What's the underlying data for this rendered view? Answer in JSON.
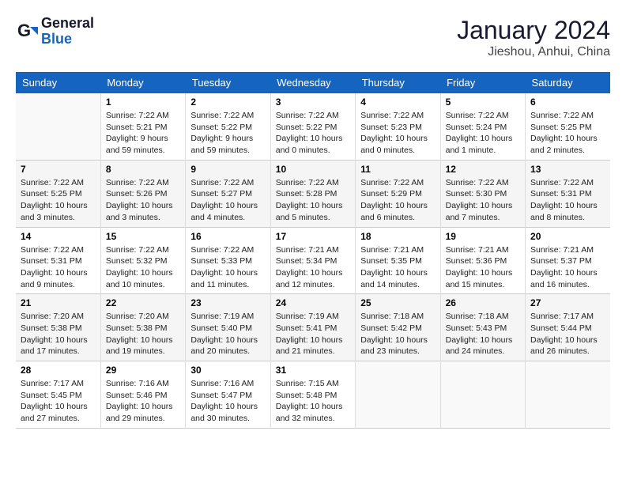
{
  "header": {
    "logo_general": "General",
    "logo_blue": "Blue",
    "title": "January 2024",
    "subtitle": "Jieshou, Anhui, China"
  },
  "weekdays": [
    "Sunday",
    "Monday",
    "Tuesday",
    "Wednesday",
    "Thursday",
    "Friday",
    "Saturday"
  ],
  "weeks": [
    [
      {
        "day": "",
        "info": ""
      },
      {
        "day": "1",
        "info": "Sunrise: 7:22 AM\nSunset: 5:21 PM\nDaylight: 9 hours\nand 59 minutes."
      },
      {
        "day": "2",
        "info": "Sunrise: 7:22 AM\nSunset: 5:22 PM\nDaylight: 9 hours\nand 59 minutes."
      },
      {
        "day": "3",
        "info": "Sunrise: 7:22 AM\nSunset: 5:22 PM\nDaylight: 10 hours\nand 0 minutes."
      },
      {
        "day": "4",
        "info": "Sunrise: 7:22 AM\nSunset: 5:23 PM\nDaylight: 10 hours\nand 0 minutes."
      },
      {
        "day": "5",
        "info": "Sunrise: 7:22 AM\nSunset: 5:24 PM\nDaylight: 10 hours\nand 1 minute."
      },
      {
        "day": "6",
        "info": "Sunrise: 7:22 AM\nSunset: 5:25 PM\nDaylight: 10 hours\nand 2 minutes."
      }
    ],
    [
      {
        "day": "7",
        "info": "Sunrise: 7:22 AM\nSunset: 5:25 PM\nDaylight: 10 hours\nand 3 minutes."
      },
      {
        "day": "8",
        "info": "Sunrise: 7:22 AM\nSunset: 5:26 PM\nDaylight: 10 hours\nand 3 minutes."
      },
      {
        "day": "9",
        "info": "Sunrise: 7:22 AM\nSunset: 5:27 PM\nDaylight: 10 hours\nand 4 minutes."
      },
      {
        "day": "10",
        "info": "Sunrise: 7:22 AM\nSunset: 5:28 PM\nDaylight: 10 hours\nand 5 minutes."
      },
      {
        "day": "11",
        "info": "Sunrise: 7:22 AM\nSunset: 5:29 PM\nDaylight: 10 hours\nand 6 minutes."
      },
      {
        "day": "12",
        "info": "Sunrise: 7:22 AM\nSunset: 5:30 PM\nDaylight: 10 hours\nand 7 minutes."
      },
      {
        "day": "13",
        "info": "Sunrise: 7:22 AM\nSunset: 5:31 PM\nDaylight: 10 hours\nand 8 minutes."
      }
    ],
    [
      {
        "day": "14",
        "info": "Sunrise: 7:22 AM\nSunset: 5:31 PM\nDaylight: 10 hours\nand 9 minutes."
      },
      {
        "day": "15",
        "info": "Sunrise: 7:22 AM\nSunset: 5:32 PM\nDaylight: 10 hours\nand 10 minutes."
      },
      {
        "day": "16",
        "info": "Sunrise: 7:22 AM\nSunset: 5:33 PM\nDaylight: 10 hours\nand 11 minutes."
      },
      {
        "day": "17",
        "info": "Sunrise: 7:21 AM\nSunset: 5:34 PM\nDaylight: 10 hours\nand 12 minutes."
      },
      {
        "day": "18",
        "info": "Sunrise: 7:21 AM\nSunset: 5:35 PM\nDaylight: 10 hours\nand 14 minutes."
      },
      {
        "day": "19",
        "info": "Sunrise: 7:21 AM\nSunset: 5:36 PM\nDaylight: 10 hours\nand 15 minutes."
      },
      {
        "day": "20",
        "info": "Sunrise: 7:21 AM\nSunset: 5:37 PM\nDaylight: 10 hours\nand 16 minutes."
      }
    ],
    [
      {
        "day": "21",
        "info": "Sunrise: 7:20 AM\nSunset: 5:38 PM\nDaylight: 10 hours\nand 17 minutes."
      },
      {
        "day": "22",
        "info": "Sunrise: 7:20 AM\nSunset: 5:38 PM\nDaylight: 10 hours\nand 19 minutes."
      },
      {
        "day": "23",
        "info": "Sunrise: 7:19 AM\nSunset: 5:40 PM\nDaylight: 10 hours\nand 20 minutes."
      },
      {
        "day": "24",
        "info": "Sunrise: 7:19 AM\nSunset: 5:41 PM\nDaylight: 10 hours\nand 21 minutes."
      },
      {
        "day": "25",
        "info": "Sunrise: 7:18 AM\nSunset: 5:42 PM\nDaylight: 10 hours\nand 23 minutes."
      },
      {
        "day": "26",
        "info": "Sunrise: 7:18 AM\nSunset: 5:43 PM\nDaylight: 10 hours\nand 24 minutes."
      },
      {
        "day": "27",
        "info": "Sunrise: 7:17 AM\nSunset: 5:44 PM\nDaylight: 10 hours\nand 26 minutes."
      }
    ],
    [
      {
        "day": "28",
        "info": "Sunrise: 7:17 AM\nSunset: 5:45 PM\nDaylight: 10 hours\nand 27 minutes."
      },
      {
        "day": "29",
        "info": "Sunrise: 7:16 AM\nSunset: 5:46 PM\nDaylight: 10 hours\nand 29 minutes."
      },
      {
        "day": "30",
        "info": "Sunrise: 7:16 AM\nSunset: 5:47 PM\nDaylight: 10 hours\nand 30 minutes."
      },
      {
        "day": "31",
        "info": "Sunrise: 7:15 AM\nSunset: 5:48 PM\nDaylight: 10 hours\nand 32 minutes."
      },
      {
        "day": "",
        "info": ""
      },
      {
        "day": "",
        "info": ""
      },
      {
        "day": "",
        "info": ""
      }
    ]
  ]
}
